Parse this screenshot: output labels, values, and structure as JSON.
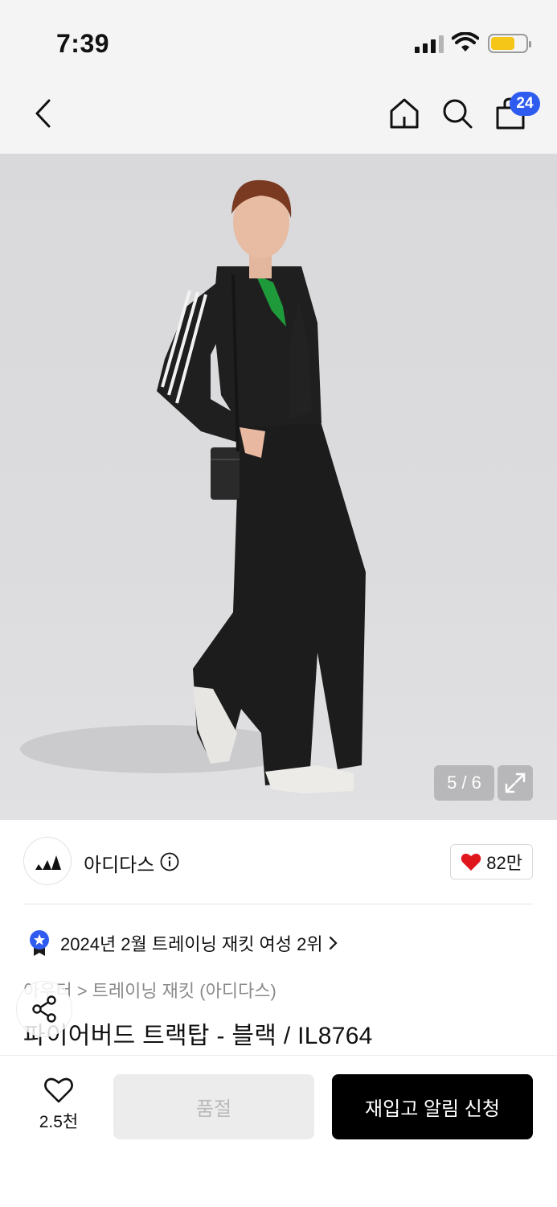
{
  "status_bar": {
    "time": "7:39"
  },
  "nav": {
    "cart_count": "24"
  },
  "gallery": {
    "counter": "5 / 6"
  },
  "brand": {
    "name": "아디다스",
    "likes": "82만"
  },
  "ranking": {
    "text": "2024년 2월 트레이닝 재킷 여성 2위"
  },
  "breadcrumb": {
    "category": "아우터",
    "subcategory": "트레이닝 재킷 (아디다스)"
  },
  "product": {
    "title": "파이어버드 트랙탑 - 블랙 / IL8764"
  },
  "bottom_bar": {
    "wish_count": "2.5천",
    "soldout_label": "품절",
    "restock_label": "재입고 알림 신청"
  },
  "colors": {
    "badge": "#2f5cf0",
    "heart": "#e0161d",
    "primary_button": "#000000"
  }
}
